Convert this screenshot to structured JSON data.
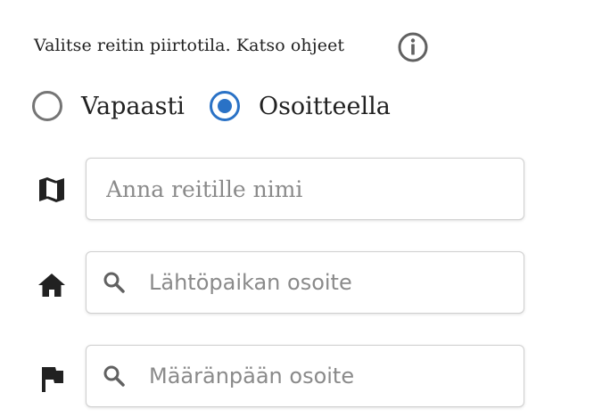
{
  "instruction": {
    "text": "Valitse reitin piirtotila. Katso ohjeet",
    "info_icon": "info-circle-icon"
  },
  "draw_mode": {
    "options": [
      {
        "label": "Vapaasti",
        "selected": false
      },
      {
        "label": "Osoitteella",
        "selected": true
      }
    ],
    "accent_color": "#2a72c6"
  },
  "fields": {
    "route_name": {
      "icon": "map-icon",
      "value": "",
      "placeholder": "Anna reitille nimi"
    },
    "start_address": {
      "icon": "home-icon",
      "search_icon": "search-icon",
      "value": "",
      "placeholder": "Lähtöpaikan osoite"
    },
    "destination_address": {
      "icon": "flag-icon",
      "search_icon": "search-icon",
      "value": "",
      "placeholder": "Määränpään osoite"
    }
  }
}
